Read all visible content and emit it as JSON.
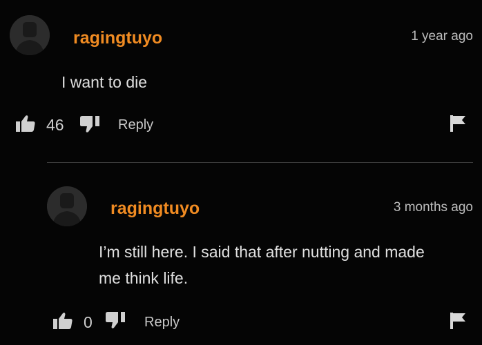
{
  "comments": [
    {
      "username": "ragingtuyo",
      "time": "1 year ago",
      "text": "I want to die",
      "likes": "46",
      "reply_label": "Reply",
      "icons": [
        "avatar",
        "thumbs-up-icon",
        "thumbs-down-icon",
        "flag-icon"
      ]
    },
    {
      "username": "ragingtuyo",
      "time": "3 months ago",
      "text_lines": [
        "I’m still here. I said that after nutting and made",
        "me think life."
      ],
      "likes": "0",
      "reply_label": "Reply",
      "icons": [
        "avatar",
        "thumbs-up-icon",
        "thumbs-down-icon",
        "flag-icon"
      ]
    }
  ],
  "colors": {
    "background": "#050505",
    "username": "#f08b22",
    "text": "#e0e0e0",
    "avatar": "#2c2c2c"
  }
}
